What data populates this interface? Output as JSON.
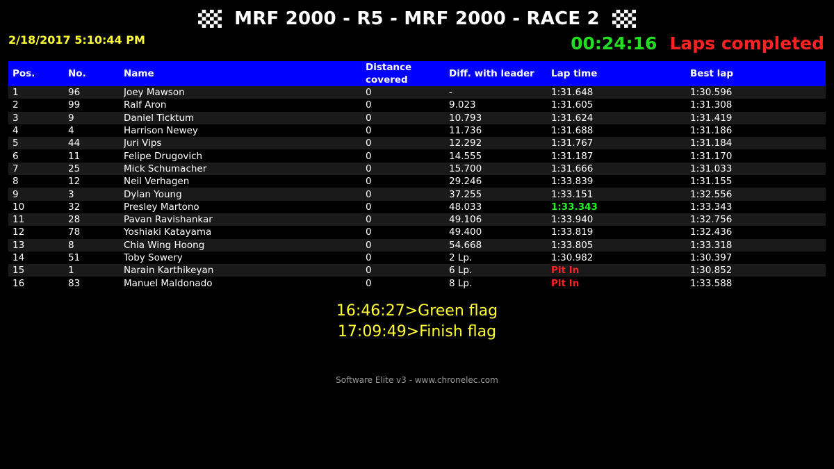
{
  "header": {
    "title": "MRF 2000 - R5 - MRF 2000 - RACE 2",
    "flag_icon": "checkered-flag-icon",
    "datetime": "2/18/2017 5:10:44 PM",
    "elapsed": "00:24:16",
    "status": "Laps completed"
  },
  "colors": {
    "background": "#000000",
    "header_bar": "#0000ff",
    "datetime": "#ffff33",
    "elapsed": "#22dd22",
    "status": "#ff2222",
    "best_lap_highlight": "#22ee22",
    "pit_in": "#ff2222"
  },
  "columns": {
    "pos": "Pos.",
    "no": "No.",
    "name": "Name",
    "distance_line1": "Distance",
    "distance_line2": "covered",
    "diff": "Diff. with leader",
    "lap_time": "Lap time",
    "best_lap": "Best lap"
  },
  "rows": [
    {
      "pos": "1",
      "no": "96",
      "name": "Joey Mawson",
      "distance": "0",
      "diff": "-",
      "lap_time": "1:31.648",
      "best_lap": "1:30.596"
    },
    {
      "pos": "2",
      "no": "99",
      "name": "Ralf Aron",
      "distance": "0",
      "diff": "9.023",
      "lap_time": "1:31.605",
      "best_lap": "1:31.308"
    },
    {
      "pos": "3",
      "no": "9",
      "name": "Daniel Ticktum",
      "distance": "0",
      "diff": "10.793",
      "lap_time": "1:31.624",
      "best_lap": "1:31.419"
    },
    {
      "pos": "4",
      "no": "4",
      "name": "Harrison Newey",
      "distance": "0",
      "diff": "11.736",
      "lap_time": "1:31.688",
      "best_lap": "1:31.186"
    },
    {
      "pos": "5",
      "no": "44",
      "name": "Juri Vips",
      "distance": "0",
      "diff": "12.292",
      "lap_time": "1:31.767",
      "best_lap": "1:31.184"
    },
    {
      "pos": "6",
      "no": "11",
      "name": "Felipe Drugovich",
      "distance": "0",
      "diff": "14.555",
      "lap_time": "1:31.187",
      "best_lap": "1:31.170"
    },
    {
      "pos": "7",
      "no": "25",
      "name": "Mick Schumacher",
      "distance": "0",
      "diff": "15.700",
      "lap_time": "1:31.666",
      "best_lap": "1:31.033"
    },
    {
      "pos": "8",
      "no": "12",
      "name": "Neil Verhagen",
      "distance": "0",
      "diff": "29.246",
      "lap_time": "1:33.839",
      "best_lap": "1:31.155"
    },
    {
      "pos": "9",
      "no": "3",
      "name": "Dylan Young",
      "distance": "0",
      "diff": "37.255",
      "lap_time": "1:33.151",
      "best_lap": "1:32.556"
    },
    {
      "pos": "10",
      "no": "32",
      "name": "Presley Martono",
      "distance": "0",
      "diff": "48.033",
      "lap_time": "1:33.343",
      "best_lap": "1:33.343",
      "lap_style": "green"
    },
    {
      "pos": "11",
      "no": "28",
      "name": "Pavan Ravishankar",
      "distance": "0",
      "diff": "49.106",
      "lap_time": "1:33.940",
      "best_lap": "1:32.756"
    },
    {
      "pos": "12",
      "no": "78",
      "name": "Yoshiaki Katayama",
      "distance": "0",
      "diff": "49.400",
      "lap_time": "1:33.819",
      "best_lap": "1:32.436"
    },
    {
      "pos": "13",
      "no": "8",
      "name": "Chia Wing Hoong",
      "distance": "0",
      "diff": "54.668",
      "lap_time": "1:33.805",
      "best_lap": "1:33.318"
    },
    {
      "pos": "14",
      "no": "51",
      "name": "Toby Sowery",
      "distance": "0",
      "diff": "2 Lp.",
      "lap_time": "1:30.982",
      "best_lap": "1:30.397"
    },
    {
      "pos": "15",
      "no": "1",
      "name": "Narain Karthikeyan",
      "distance": "0",
      "diff": "6 Lp.",
      "lap_time": "Pit In",
      "best_lap": "1:30.852",
      "lap_style": "red"
    },
    {
      "pos": "16",
      "no": "83",
      "name": "Manuel Maldonado",
      "distance": "0",
      "diff": "8 Lp.",
      "lap_time": "Pit In",
      "best_lap": "1:33.588",
      "lap_style": "red"
    }
  ],
  "messages": [
    "16:46:27>Green flag",
    "17:09:49>Finish flag"
  ],
  "footer": "Software Elite v3 - www.chronelec.com"
}
